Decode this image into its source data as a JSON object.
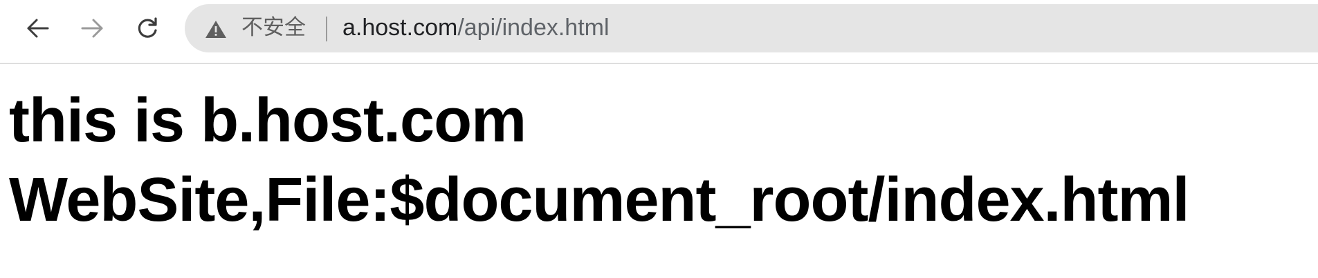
{
  "browser": {
    "nav": {
      "back": "back-arrow-icon",
      "forward": "forward-arrow-icon",
      "reload": "reload-icon"
    },
    "omnibox": {
      "security_icon": "warning-triangle-icon",
      "security_label": "不安全",
      "url_host": "a.host.com",
      "url_path": "/api/index.html"
    },
    "colors": {
      "omnibox_bg": "#e5e5e5",
      "icon_active": "#3c3c3c",
      "icon_disabled": "#9a9a9a"
    }
  },
  "page": {
    "heading": "this is b.host.com WebSite,File:$document_root/index.html"
  }
}
